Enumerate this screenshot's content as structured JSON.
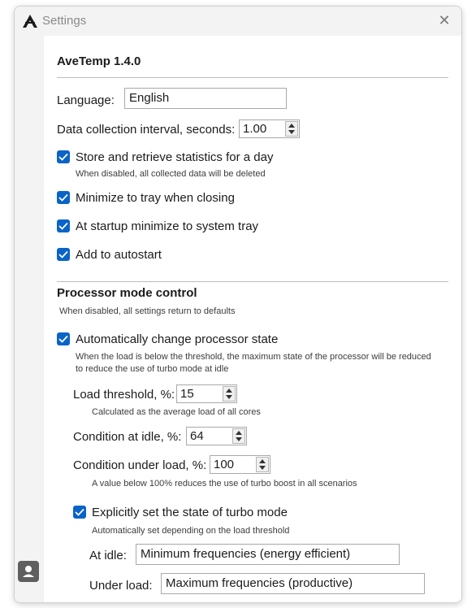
{
  "window": {
    "title": "Settings",
    "close_glyph": "✕",
    "accent": "#0a64c8"
  },
  "app": {
    "name_version": "AveTemp 1.4.0"
  },
  "language": {
    "label": "Language:",
    "value": "English"
  },
  "interval": {
    "label": "Data collection interval, seconds:",
    "value": "1.00"
  },
  "options": [
    {
      "label": "Store and retrieve statistics for a day",
      "hint": "When disabled, all collected data will be deleted",
      "checked": true
    },
    {
      "label": "Minimize to tray when closing",
      "checked": true
    },
    {
      "label": "At startup minimize to system tray",
      "checked": true
    },
    {
      "label": "Add to autostart",
      "checked": true
    }
  ],
  "processor": {
    "heading": "Processor mode control",
    "hint": "When disabled, all settings return to defaults",
    "auto_change": {
      "label": "Automatically change processor state",
      "hint_line1": "When the load is below the threshold, the maximum state of the processor will be reduced",
      "hint_line2": "to reduce the use of turbo mode at idle",
      "checked": true
    },
    "load_threshold": {
      "label": "Load threshold, %:",
      "value": "15",
      "hint": "Calculated as the average load of all cores"
    },
    "idle_condition": {
      "label": "Condition at idle, %:",
      "value": "64"
    },
    "load_condition": {
      "label": "Condition under load, %:",
      "value": "100",
      "hint": "A value below 100% reduces the use of turbo boost in all scenarios"
    },
    "turbo": {
      "label": "Explicitly set the state of turbo mode",
      "hint": "Automatically set depending on the load threshold",
      "checked": true,
      "at_idle_label": "At idle:",
      "at_idle_value": "Minimum frequencies (energy efficient)",
      "under_load_label": "Under load:",
      "under_load_value": "Maximum frequencies (productive)"
    }
  },
  "icons": {
    "app": "avetemp-logo-icon",
    "close": "close-icon",
    "user": "user-icon",
    "check": "checkmark-icon"
  }
}
